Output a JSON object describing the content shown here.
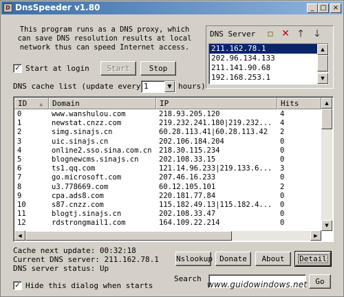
{
  "window": {
    "title": "DnsSpeeder v1.80",
    "app_icon": "app-icon",
    "controls": [
      "_",
      "□",
      "×"
    ]
  },
  "intro_text": "This program runs as a DNS proxy, which can save DNS resolution results at local network thus can speed Internet access.",
  "start_at_login": {
    "label": "Start at login",
    "checked": true
  },
  "buttons": {
    "start": "Start",
    "stop": "Stop",
    "nslookup": "Nslookup",
    "donate": "Donate",
    "about": "About",
    "detail": "Detail",
    "go": "Go"
  },
  "dns_server": {
    "title": "DNS Server",
    "icons": [
      "new-icon",
      "delete-icon",
      "move-up-icon",
      "move-down-icon"
    ],
    "servers": [
      "211.162.78.1",
      "202.96.134.133",
      "211.141.90.68",
      "192.168.253.1"
    ],
    "selected_index": 0
  },
  "cache": {
    "label": "DNS cache list  (update every",
    "interval": "1",
    "unit": "hours)"
  },
  "table": {
    "columns": [
      "ID",
      "Domain",
      "IP",
      "Hits"
    ],
    "rows": [
      [
        "0",
        "www.wanshulou.com",
        "218.93.205.120",
        "4"
      ],
      [
        "1",
        "newstat.cnzz.com",
        "219.232.241.180|219.232...",
        "4"
      ],
      [
        "2",
        "simg.sinajs.cn",
        "60.28.113.41|60.28.113.42",
        "2"
      ],
      [
        "3",
        "uic.sinajs.cn",
        "202.106.184.204",
        "0"
      ],
      [
        "4",
        "online2.sso.sina.com.cn",
        "218.30.115.234",
        "0"
      ],
      [
        "5",
        "blognewcms.sinajs.cn",
        "202.108.33.15",
        "0"
      ],
      [
        "6",
        "ts1.qq.com",
        "121.14.96.233|219.133.6...",
        "3"
      ],
      [
        "7",
        "go.microsoft.com",
        "207.46.16.233",
        "0"
      ],
      [
        "8",
        "u3.778669.com",
        "60.12.105.101",
        "2"
      ],
      [
        "9",
        "cpa.ads8.com",
        "220.181.77.84",
        "0"
      ],
      [
        "10",
        "s87.cnzz.com",
        "115.182.49.13|115.182.4...",
        "0"
      ],
      [
        "11",
        "blogtj.sinajs.cn",
        "202.108.33.47",
        "0"
      ],
      [
        "12",
        "rdstrongmail1.com",
        "164.109.22.214",
        "0"
      ]
    ]
  },
  "status": {
    "cache_next_update": "Cache next update:  00:32:18",
    "current_dns_server": "Current DNS server:  211.162.78.1",
    "dns_server_status": "DNS server status:  Up"
  },
  "hide_dialog": {
    "label": "Hide this dialog when starts",
    "checked": true
  },
  "search": {
    "label": "Search",
    "value": ""
  },
  "watermark": "www.guidowindows.net"
}
